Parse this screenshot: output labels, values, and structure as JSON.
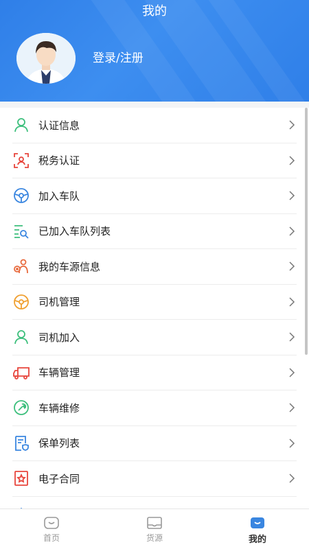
{
  "header": {
    "title": "我的",
    "login_label": "登录/注册"
  },
  "menu": {
    "items": [
      {
        "label": "认证信息",
        "icon": "user-icon",
        "color": "#3cbf7c"
      },
      {
        "label": "税务认证",
        "icon": "face-scan-icon",
        "color": "#e8453c"
      },
      {
        "label": "加入车队",
        "icon": "steering-wheel-icon",
        "color": "#3a86e0"
      },
      {
        "label": "已加入车队列表",
        "icon": "list-search-icon",
        "color": "#3cbf7c"
      },
      {
        "label": "我的车源信息",
        "icon": "driver-icon",
        "color": "#e8693c"
      },
      {
        "label": "司机管理",
        "icon": "steering-wheel-icon",
        "color": "#f0a030"
      },
      {
        "label": "司机加入",
        "icon": "user-icon",
        "color": "#3cbf7c"
      },
      {
        "label": "车辆管理",
        "icon": "truck-icon",
        "color": "#e8453c"
      },
      {
        "label": "车辆维修",
        "icon": "wrench-icon",
        "color": "#3cbf7c"
      },
      {
        "label": "保单列表",
        "icon": "document-shield-icon",
        "color": "#3a86e0"
      },
      {
        "label": "电子合同",
        "icon": "contract-icon",
        "color": "#e8453c"
      }
    ]
  },
  "tabbar": {
    "tabs": [
      {
        "label": "首页",
        "icon": "home-icon"
      },
      {
        "label": "货源",
        "icon": "cargo-icon"
      },
      {
        "label": "我的",
        "icon": "profile-icon",
        "active": true
      }
    ]
  },
  "colors": {
    "header": "#2f7fe8",
    "active_tab": "#3a86e0",
    "inactive_tab": "#999999"
  }
}
